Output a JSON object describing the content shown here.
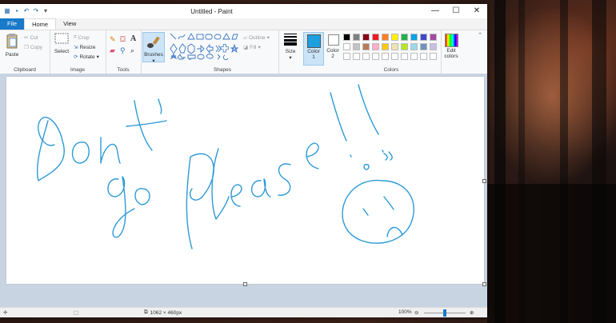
{
  "window": {
    "title": "Untitled - Paint"
  },
  "tabs": [
    {
      "label": "File"
    },
    {
      "label": "Home"
    },
    {
      "label": "View"
    }
  ],
  "ribbon": {
    "clipboard": {
      "label": "Clipboard",
      "paste": "Paste",
      "cut": "Cut",
      "copy": "Copy"
    },
    "image": {
      "label": "Image",
      "select": "Select",
      "crop": "Crop",
      "resize": "Resize",
      "rotate": "Rotate"
    },
    "tools": {
      "label": "Tools"
    },
    "brushes": {
      "label": "Brushes"
    },
    "shapes": {
      "label": "Shapes",
      "outline": "Outline",
      "fill": "Fill"
    },
    "size": {
      "label": "Size"
    },
    "color1": {
      "label": "Color 1",
      "label_line1": "Color",
      "label_line2": "1",
      "value": "#1e9fe0"
    },
    "color2": {
      "label_line1": "Color",
      "label_line2": "2",
      "value": "#ffffff"
    },
    "colors": {
      "label": "Colors"
    },
    "edit_colors": {
      "line1": "Edit",
      "line2": "colors"
    }
  },
  "palette_row1": [
    "#000000",
    "#7f7f7f",
    "#880015",
    "#ed1c24",
    "#ff7f27",
    "#fff200",
    "#22b14c",
    "#00a2e8",
    "#3f48cc",
    "#a349a4"
  ],
  "palette_row2": [
    "#ffffff",
    "#c3c3c3",
    "#b97a57",
    "#ffaec9",
    "#ffc90e",
    "#efe4b0",
    "#b5e61d",
    "#99d9ea",
    "#7092be",
    "#c8bfe7"
  ],
  "status": {
    "dimensions": "1062 × 460px",
    "zoom": "100%",
    "zoom_level": 0.5
  },
  "drawing": {
    "stroke_color": "#2d9ad8"
  }
}
